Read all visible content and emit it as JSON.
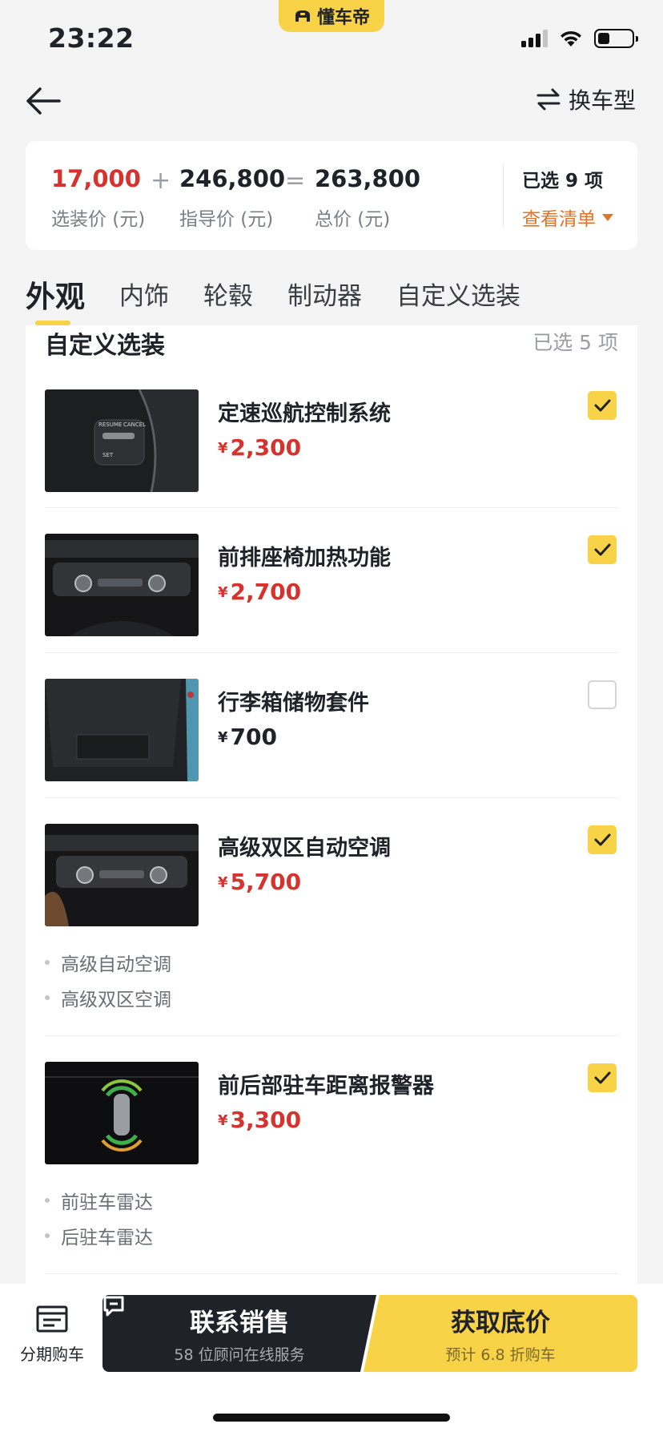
{
  "status_bar": {
    "time": "23:22",
    "app_name": "懂车帝"
  },
  "nav": {
    "switch_label": "换车型"
  },
  "price_summary": {
    "option_price": "17,000",
    "option_label": "选装价 (元)",
    "plus": "+",
    "msrp": "246,800",
    "msrp_label": "指导价 (元)",
    "equals": "=",
    "total": "263,800",
    "total_label": "总价 (元)",
    "selected_count": "已选 9 项",
    "view_list": "查看清单"
  },
  "tabs": [
    "外观",
    "内饰",
    "轮毂",
    "制动器",
    "自定义选装"
  ],
  "section": {
    "title": "自定义选装",
    "count": "已选 5 项"
  },
  "options": [
    {
      "name": "定速巡航控制系统",
      "currency": "¥",
      "price": "2,300",
      "checked": true,
      "features": []
    },
    {
      "name": "前排座椅加热功能",
      "currency": "¥",
      "price": "2,700",
      "checked": true,
      "features": []
    },
    {
      "name": "行李箱储物套件",
      "currency": "¥",
      "price": "700",
      "checked": false,
      "features": []
    },
    {
      "name": "高级双区自动空调",
      "currency": "¥",
      "price": "5,700",
      "checked": true,
      "features": [
        "高级自动空调",
        "高级双区空调"
      ]
    },
    {
      "name": "前后部驻车距离报警器",
      "currency": "¥",
      "price": "3,300",
      "checked": true,
      "features": [
        "前驻车雷达",
        "后驻车雷达"
      ]
    }
  ],
  "bottom": {
    "installment": "分期购车",
    "contact_main": "联系销售",
    "contact_sub": "58 位顾问在线服务",
    "price_main": "获取底价",
    "price_sub": "预计 6.8 折购车"
  },
  "colors": {
    "accent": "#f8d247",
    "price_red": "#d6322e",
    "link_orange": "#e0742b",
    "dark_button": "#1f2329"
  }
}
